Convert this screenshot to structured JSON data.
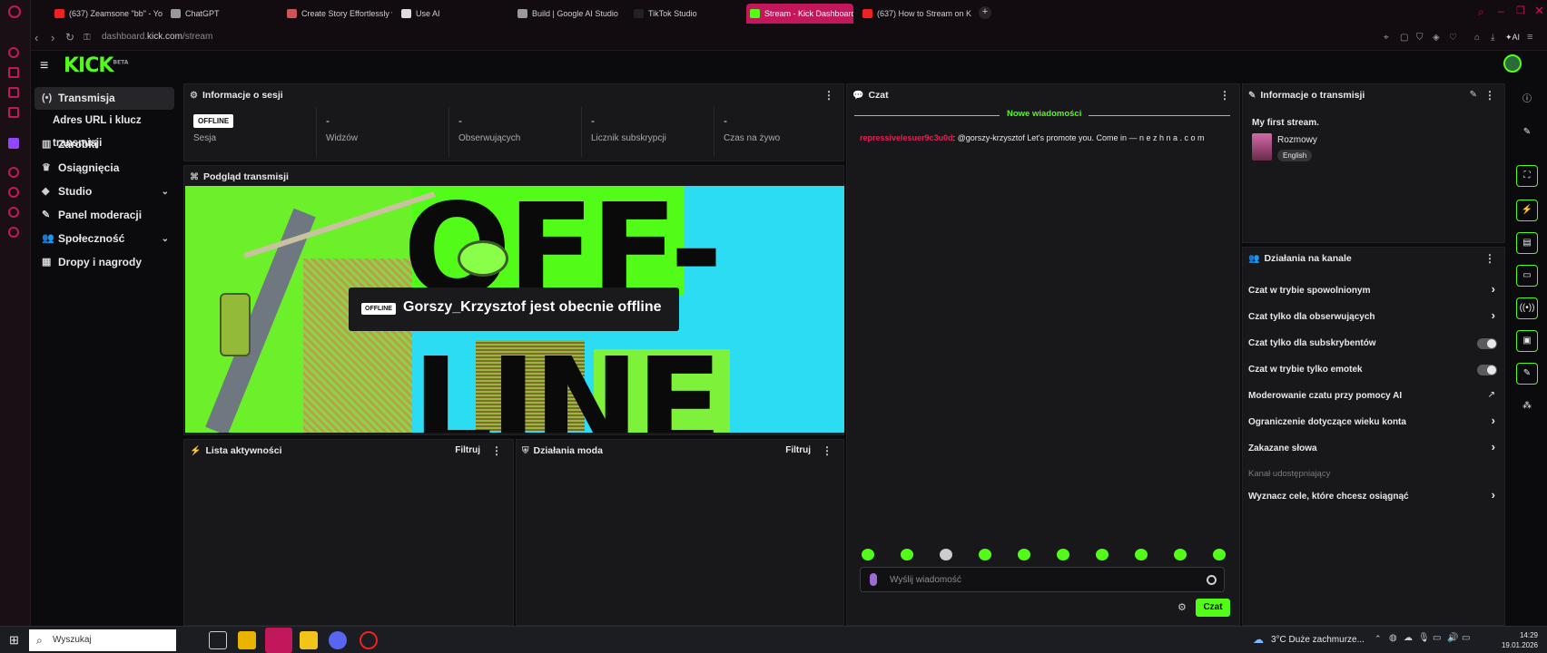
{
  "browser": {
    "tabs": [
      {
        "label": "(637) Zeamsone \"bb\" - Yo",
        "fav": "#e22"
      },
      {
        "label": "ChatGPT",
        "fav": "#999"
      },
      {
        "label": "Create Story Effortlessly w",
        "fav": "#c55"
      },
      {
        "label": "Use AI",
        "fav": "#ddd"
      },
      {
        "label": "Build | Google AI Studio",
        "fav": "#999"
      },
      {
        "label": "TikTok Studio",
        "fav": "#222"
      },
      {
        "label": "Stream - Kick Dashboard",
        "fav": "#53fc18"
      },
      {
        "label": "(637) How to Stream on Ki",
        "fav": "#e22"
      }
    ],
    "url_prefix": "dashboard.",
    "url_domain": "kick.com",
    "url_path": "/stream"
  },
  "header": {
    "logo": "KICK",
    "logo_beta": "BETA"
  },
  "sidebar": {
    "items": [
      {
        "label": "Transmisja",
        "icon": "broadcast-icon"
      },
      {
        "label": "Adres URL i klucz transmisji",
        "icon": ""
      },
      {
        "label": "Zarobki",
        "icon": "chart-icon"
      },
      {
        "label": "Osiągnięcia",
        "icon": "trophy-icon"
      },
      {
        "label": "Studio",
        "icon": "layers-icon"
      },
      {
        "label": "Panel moderacji",
        "icon": "wrench-icon"
      },
      {
        "label": "Społeczność",
        "icon": "users-icon"
      },
      {
        "label": "Dropy i nagrody",
        "icon": "gift-icon"
      }
    ]
  },
  "session": {
    "title": "Informacje o sesji",
    "badge": "OFFLINE",
    "stats": [
      {
        "value": "",
        "label": "Sesja"
      },
      {
        "value": "-",
        "label": "Widzów"
      },
      {
        "value": "-",
        "label": "Obserwujących"
      },
      {
        "value": "-",
        "label": "Licznik subskrypcji"
      },
      {
        "value": "-",
        "label": "Czas na żywo"
      }
    ]
  },
  "preview": {
    "title": "Podgląd transmisji",
    "big_top": "OFF-",
    "big_bottom": "LINE",
    "card_tag": "OFFLINE",
    "card_text": "Gorszy_Krzysztof jest obecnie offline"
  },
  "activity": {
    "title": "Lista aktywności",
    "filter": "Filtruj"
  },
  "modactions": {
    "title": "Działania moda",
    "filter": "Filtruj"
  },
  "chat": {
    "title": "Czat",
    "new_messages": "Nowe wiadomości",
    "message_user": "repressivelesuer9c3u0d",
    "message_text": ": @gorszy-krzysztof Let's promote you. Come in — n e z h n a . c o m",
    "input_placeholder": "Wyślij wiadomość",
    "send_label": "Czat"
  },
  "stream_info": {
    "title": "Informacje o transmisji",
    "stream_title": "My first stream.",
    "category": "Rozmowy",
    "language": "English"
  },
  "channel_actions": {
    "title": "Działania na kanale",
    "items": [
      {
        "label": "Czat w trybie spowolnionym",
        "control": "arrow"
      },
      {
        "label": "Czat tylko dla obserwujących",
        "control": "arrow"
      },
      {
        "label": "Czat tylko dla subskrybentów",
        "control": "toggle"
      },
      {
        "label": "Czat w trybie tylko emotek",
        "control": "toggle"
      },
      {
        "label": "Moderowanie czatu przy pomocy AI",
        "control": "external"
      },
      {
        "label": "Ograniczenie dotyczące wieku konta",
        "control": "arrow"
      },
      {
        "label": "Zakazane słowa",
        "control": "arrow"
      },
      {
        "label": "Kanał udostępniający",
        "control": "none"
      },
      {
        "label": "Wyznacz cele, które chcesz osiągnąć",
        "control": "arrow"
      }
    ]
  },
  "taskbar": {
    "search_placeholder": "Wyszukaj",
    "weather": "3°C  Duże zachmurze...",
    "time": "14:29",
    "date": "19.01.2026"
  },
  "colors": {
    "accent": "#53fc18",
    "opera": "#c2185b",
    "panel": "#18181b"
  }
}
